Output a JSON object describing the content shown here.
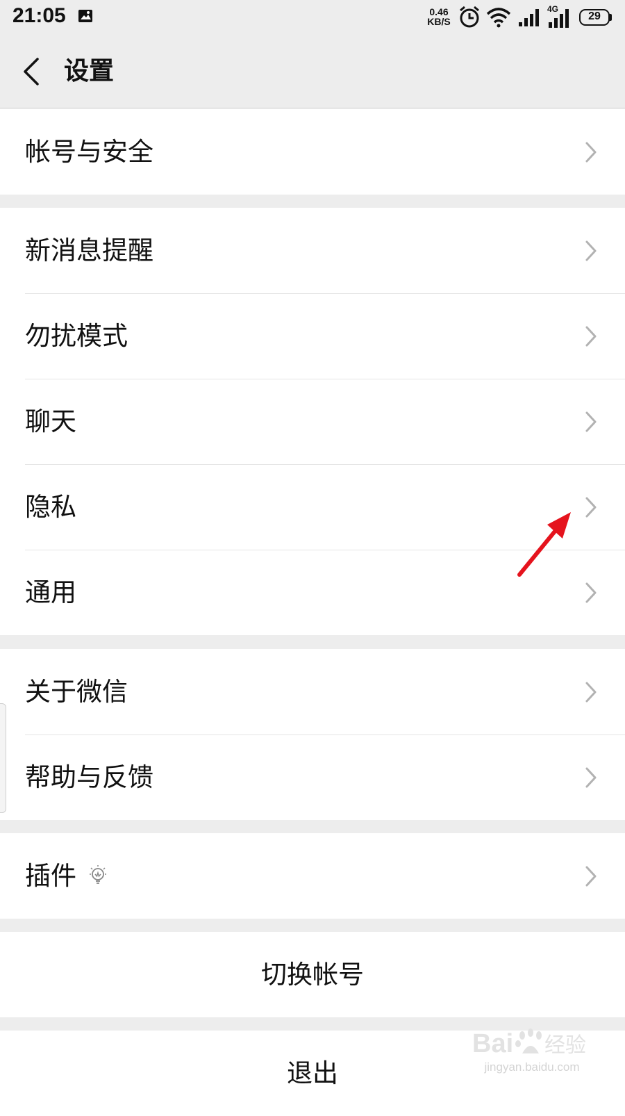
{
  "status_bar": {
    "time": "21:05",
    "net_speed_value": "0.46",
    "net_speed_unit": "KB/S",
    "network_type": "4G",
    "battery_level": "29",
    "icons": [
      "image-notification-icon",
      "alarm-icon",
      "wifi-icon",
      "signal-icon",
      "signal-4g-icon",
      "battery-icon"
    ]
  },
  "nav": {
    "title": "设置",
    "back_icon": "chevron-left-icon"
  },
  "groups": [
    {
      "items": [
        {
          "label": "帐号与安全"
        }
      ]
    },
    {
      "items": [
        {
          "label": "新消息提醒"
        },
        {
          "label": "勿扰模式"
        },
        {
          "label": "聊天"
        },
        {
          "label": "隐私"
        },
        {
          "label": "通用"
        }
      ]
    },
    {
      "items": [
        {
          "label": "关于微信"
        },
        {
          "label": "帮助与反馈"
        }
      ]
    },
    {
      "items": [
        {
          "label": "插件",
          "badge_icon": "lightbulb-icon"
        }
      ]
    }
  ],
  "actions": {
    "switch_account": "切换帐号",
    "logout": "退出"
  },
  "annotation": {
    "color": "#e5131d",
    "points_to": "隐私"
  },
  "watermark": {
    "brand": "Baidu经验",
    "url": "jingyan.baidu.com"
  },
  "colors": {
    "background": "#ededed",
    "cell": "#ffffff",
    "text": "#111111",
    "chevron": "#b2b2b2"
  }
}
